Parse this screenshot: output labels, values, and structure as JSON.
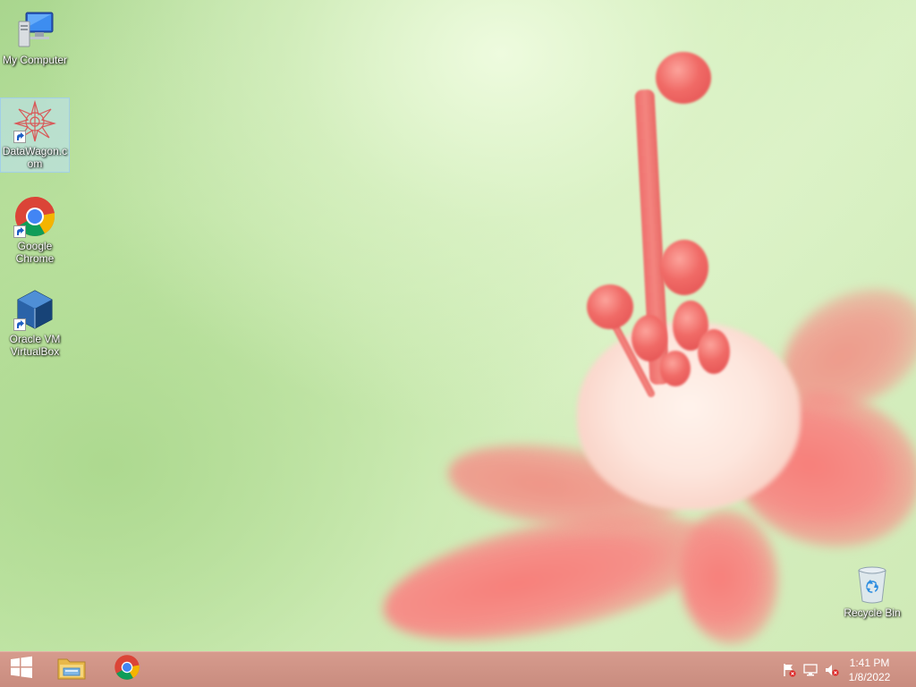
{
  "desktop": {
    "icons": [
      {
        "label": "My Computer",
        "icon": "my-computer-icon",
        "selected": false
      },
      {
        "label": "DataWagon.com",
        "icon": "datawagon-icon",
        "selected": true
      },
      {
        "label": "Google Chrome",
        "icon": "chrome-icon",
        "selected": false
      },
      {
        "label": "Oracle VM VirtualBox",
        "icon": "virtualbox-icon",
        "selected": false
      },
      {
        "label": "Recycle Bin",
        "icon": "recycle-bin-icon",
        "selected": false
      }
    ]
  },
  "taskbar": {
    "pinned": [
      {
        "name": "start",
        "icon": "windows-logo-icon"
      },
      {
        "name": "file-explorer",
        "icon": "folder-icon"
      },
      {
        "name": "google-chrome",
        "icon": "chrome-icon"
      }
    ],
    "tray": [
      {
        "icon": "action-center-flag-icon"
      },
      {
        "icon": "network-icon"
      },
      {
        "icon": "volume-muted-icon"
      }
    ],
    "clock": {
      "time": "1:41 PM",
      "date": "1/8/2022"
    }
  },
  "colors": {
    "taskbar": "#c98c7f",
    "petal": "#f4857f",
    "wallpaper_green": "#c6e8ad"
  }
}
